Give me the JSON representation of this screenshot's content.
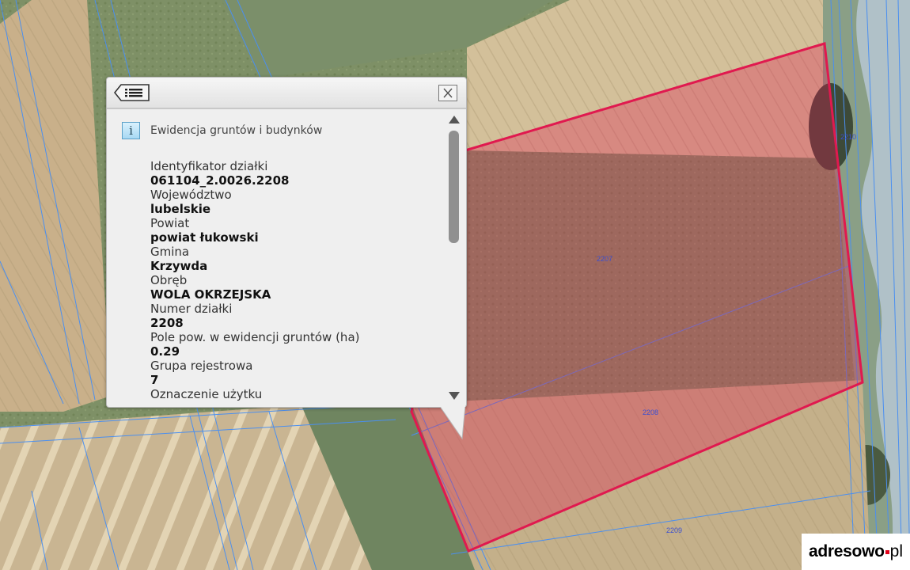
{
  "map": {
    "parcel_labels": [
      "2207",
      "2208",
      "2209",
      "2210"
    ],
    "selected_parcel_color": "#e0194f",
    "boundary_color": "#4a8ff0"
  },
  "popup": {
    "menu_icon": "list-back-icon",
    "close_icon": "close-icon",
    "info_icon": "i",
    "section_title": "Ewidencja gruntów i budynków",
    "fields": [
      {
        "label": "Identyfikator działki",
        "value": "061104_2.0026.2208"
      },
      {
        "label": "Województwo",
        "value": "lubelskie"
      },
      {
        "label": "Powiat",
        "value": "powiat łukowski"
      },
      {
        "label": "Gmina",
        "value": "Krzywda"
      },
      {
        "label": "Obręb",
        "value": "WOLA OKRZEJSKA"
      },
      {
        "label": "Numer działki",
        "value": "2208"
      },
      {
        "label": "Pole pow. w ewidencji gruntów (ha)",
        "value": "0.29"
      },
      {
        "label": "Grupa rejestrowa",
        "value": "7"
      },
      {
        "label": "Oznaczenie użytku",
        "value": ""
      }
    ]
  },
  "brand": {
    "name": "adresowo",
    "tld": "pl"
  }
}
